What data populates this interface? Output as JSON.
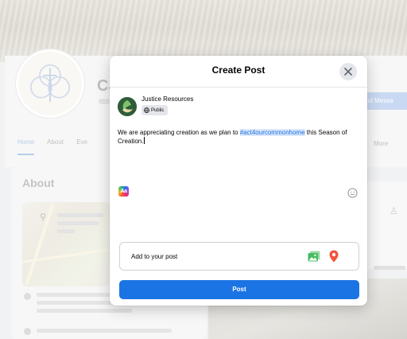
{
  "background": {
    "page_name": "Ca",
    "section_title": "About",
    "nav": [
      "Home",
      "About",
      "Eve"
    ],
    "send_message": "nd Messa",
    "right_nav": "More"
  },
  "modal": {
    "title": "Create Post",
    "author": {
      "name": "Justice Resources",
      "audience": "Public"
    },
    "post_text": {
      "before": "We are appreciating creation as we plan to ",
      "hashtag": "#act4ourcommonhome",
      "after": " this Season of Creation."
    },
    "add_to_post": "Add to your post",
    "post_button": "Post",
    "icons": {
      "close": "close-icon",
      "audience": "globe-icon",
      "background": "text-background-icon",
      "emoji": "emoji-icon",
      "photo": "photo-icon",
      "location": "location-pin-icon"
    }
  },
  "colors": {
    "primary": "#1b74e4",
    "hashtag_highlight": "#dbe7fa",
    "photo_icon": "#45bd62",
    "location_icon": "#f5533d"
  }
}
